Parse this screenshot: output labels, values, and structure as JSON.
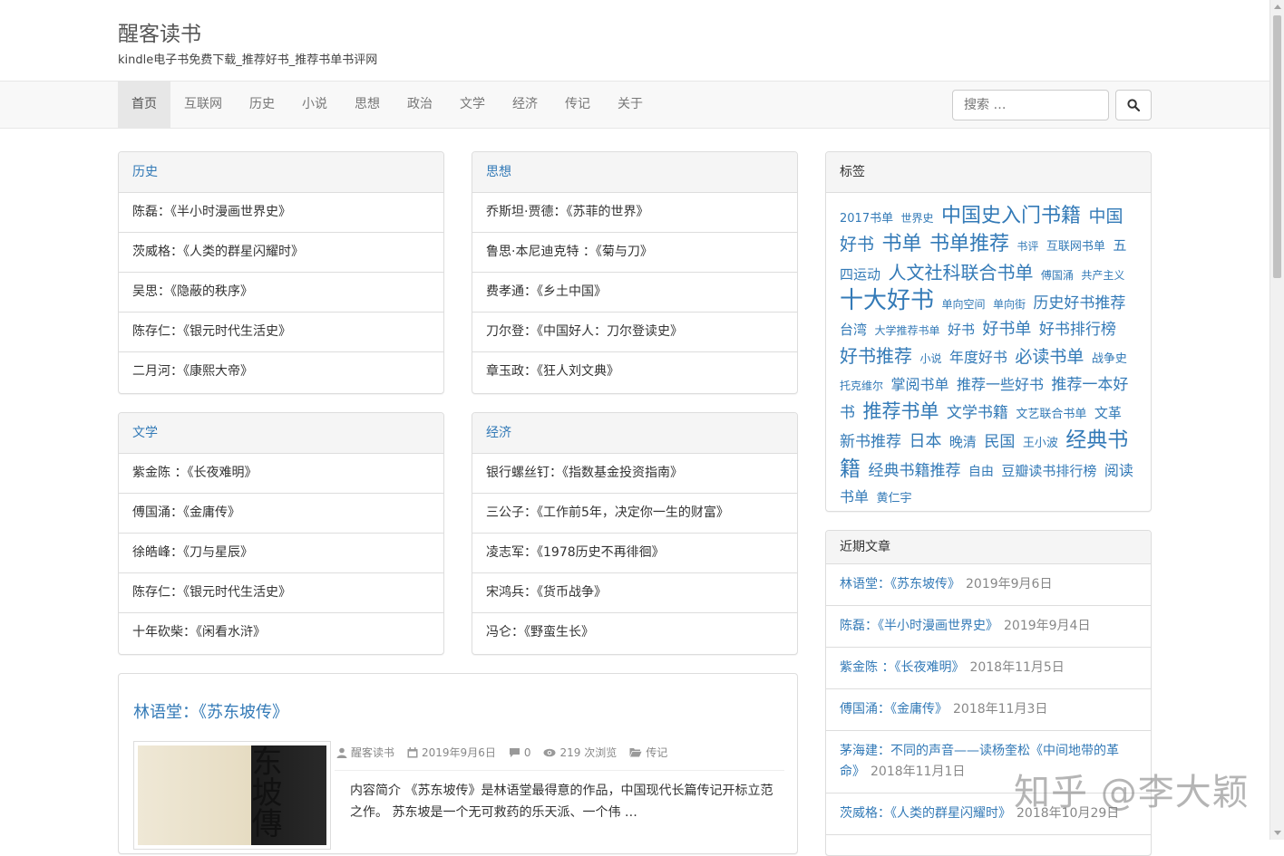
{
  "site": {
    "title": "醒客读书",
    "description": "kindle电子书免费下载_推荐好书_推荐书单书评网"
  },
  "nav": {
    "items": [
      "首页",
      "互联网",
      "历史",
      "小说",
      "思想",
      "政治",
      "文学",
      "经济",
      "传记",
      "关于"
    ],
    "active_index": 0,
    "search_placeholder": "搜索 …"
  },
  "panels": {
    "history": {
      "title": "历史",
      "items": [
        "陈磊：《半小时漫画世界史》",
        "茨威格：《人类的群星闪耀时》",
        "吴思：《隐蔽的秩序》",
        "陈存仁：《银元时代生活史》",
        "二月河：《康熙大帝》"
      ]
    },
    "thought": {
      "title": "思想",
      "items": [
        "乔斯坦·贾德：《苏菲的世界》",
        "鲁思·本尼迪克特 ：《菊与刀》",
        "费孝通：《乡土中国》",
        "刀尔登：《中国好人：刀尔登读史》",
        "章玉政：《狂人刘文典》"
      ]
    },
    "literature": {
      "title": "文学",
      "items": [
        "紫金陈 ：《长夜难明》",
        "傅国涌：《金庸传》",
        "徐皓峰：《刀与星辰》",
        "陈存仁：《银元时代生活史》",
        "十年砍柴：《闲看水浒》"
      ]
    },
    "economy": {
      "title": "经济",
      "items": [
        "银行螺丝钉：《指数基金投资指南》",
        "三公子：《工作前5年，决定你一生的财富》",
        "凌志军：《1978历史不再徘徊》",
        "宋鸿兵：《货币战争》",
        "冯仑：《野蛮生长》"
      ]
    }
  },
  "tags": {
    "title": "标签",
    "items": [
      {
        "text": "2017书单",
        "size": 13
      },
      {
        "text": "世界史",
        "size": 12
      },
      {
        "text": "中国史入门书籍",
        "size": 22
      },
      {
        "text": "中国好书",
        "size": 19
      },
      {
        "text": "书单",
        "size": 22
      },
      {
        "text": "书单推荐",
        "size": 22
      },
      {
        "text": "书评",
        "size": 12
      },
      {
        "text": "互联网书单",
        "size": 13
      },
      {
        "text": "五四运动",
        "size": 15
      },
      {
        "text": "人文社科联合书单",
        "size": 20
      },
      {
        "text": "傅国涌",
        "size": 12
      },
      {
        "text": "共产主义",
        "size": 12
      },
      {
        "text": "十大好书",
        "size": 26
      },
      {
        "text": "单向空间",
        "size": 12
      },
      {
        "text": "单向街",
        "size": 12
      },
      {
        "text": "历史好书推荐",
        "size": 17
      },
      {
        "text": "台湾",
        "size": 15
      },
      {
        "text": "大学推荐书单",
        "size": 12
      },
      {
        "text": "好书",
        "size": 15
      },
      {
        "text": "好书单",
        "size": 18
      },
      {
        "text": "好书排行榜",
        "size": 17
      },
      {
        "text": "好书推荐",
        "size": 20
      },
      {
        "text": "小说",
        "size": 12
      },
      {
        "text": "年度好书",
        "size": 16
      },
      {
        "text": "必读书单",
        "size": 19
      },
      {
        "text": "战争史",
        "size": 13
      },
      {
        "text": "托克维尔",
        "size": 12
      },
      {
        "text": "掌阅书单",
        "size": 16
      },
      {
        "text": "推荐一些好书",
        "size": 16
      },
      {
        "text": "推荐一本好书",
        "size": 17
      },
      {
        "text": "推荐书单",
        "size": 21
      },
      {
        "text": "文学书籍",
        "size": 17
      },
      {
        "text": "文艺联合书单",
        "size": 13
      },
      {
        "text": "文革",
        "size": 15
      },
      {
        "text": "新书推荐",
        "size": 17
      },
      {
        "text": "日本",
        "size": 18
      },
      {
        "text": "晚清",
        "size": 15
      },
      {
        "text": "民国",
        "size": 17
      },
      {
        "text": "王小波",
        "size": 13
      },
      {
        "text": "经典书籍",
        "size": 23
      },
      {
        "text": "经典书籍推荐",
        "size": 17
      },
      {
        "text": "自由",
        "size": 14
      },
      {
        "text": "豆瓣读书排行榜",
        "size": 15
      },
      {
        "text": "阅读书单",
        "size": 16
      },
      {
        "text": "黄仁宇",
        "size": 13
      }
    ]
  },
  "recent": {
    "title": "近期文章",
    "items": [
      {
        "title": "林语堂：《苏东坡传》",
        "date": "2019年9月6日"
      },
      {
        "title": "陈磊：《半小时漫画世界史》",
        "date": "2019年9月4日"
      },
      {
        "title": "紫金陈 ：《长夜难明》",
        "date": "2018年11月5日"
      },
      {
        "title": "傅国涌：《金庸传》",
        "date": "2018年11月3日"
      },
      {
        "title": "茅海建：不同的声音——读杨奎松《中间地带的革命》",
        "date": "2018年11月1日"
      },
      {
        "title": "茨威格：《人类的群星闪耀时》",
        "date": "2018年10月29日"
      }
    ]
  },
  "post": {
    "title": "林语堂：《苏东坡传》",
    "thumb_text": "东坡傳",
    "author": "醒客读书",
    "date": "2019年9月6日",
    "comments": "0",
    "views": "219 次浏览",
    "category": "传记",
    "excerpt": "内容简介 《苏东坡传》是林语堂最得意的作品，中国现代长篇传记开标立范之作。 苏东坡是一个无可救药的乐天派、一个伟 …"
  },
  "watermark": "知乎 @李大颖"
}
